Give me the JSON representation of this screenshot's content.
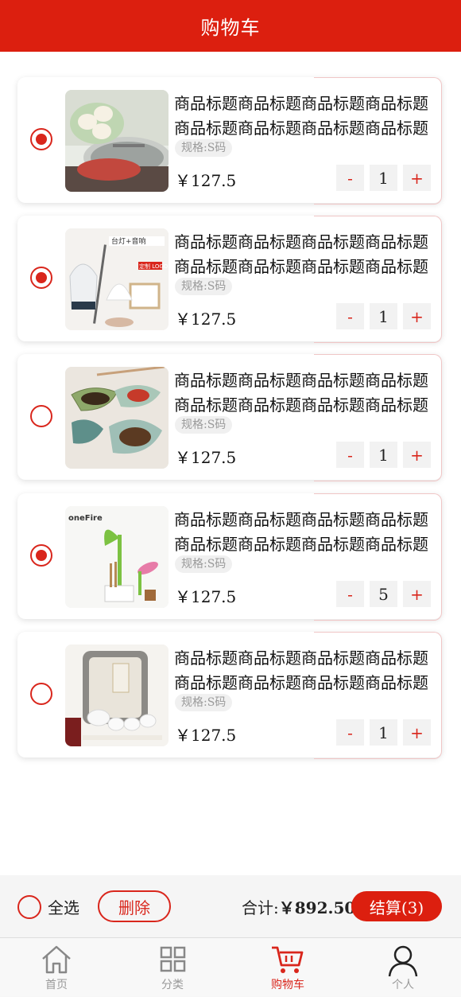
{
  "header": {
    "title": "购物车"
  },
  "items": [
    {
      "title": "商品标题商品标题商品标题商品标题商品标题商品标题商品标题商品标题",
      "spec": "规格:S码",
      "price": "￥127.5",
      "qty": "1",
      "checked": true,
      "image": "steamed-buns-pan"
    },
    {
      "title": "商品标题商品标题商品标题商品标题商品标题商品标题商品标题商品标题",
      "spec": "规格:S码",
      "price": "￥127.5",
      "qty": "1",
      "checked": true,
      "image": "desk-lamp-speaker",
      "image_texts": [
        "台灯+音响",
        "定制 LOGO"
      ]
    },
    {
      "title": "商品标题商品标题商品标题商品标题商品标题商品标题商品标题商品标题",
      "spec": "规格:S码",
      "price": "￥127.5",
      "qty": "1",
      "checked": false,
      "image": "leaf-dishes"
    },
    {
      "title": "商品标题商品标题商品标题商品标题商品标题商品标题商品标题商品标题",
      "spec": "规格:S码",
      "price": "￥127.5",
      "qty": "5",
      "checked": true,
      "image": "sprout-lamp",
      "image_texts": [
        "oneFire"
      ]
    },
    {
      "title": "商品标题商品标题商品标题商品标题商品标题商品标题商品标题商品标题",
      "spec": "规格:S码",
      "price": "￥127.5",
      "qty": "1",
      "checked": false,
      "image": "tea-set-bag"
    }
  ],
  "stepper": {
    "minus": "-",
    "plus": "+"
  },
  "footer": {
    "select_all_label": "全选",
    "delete_label": "删除",
    "total_label": "合计:",
    "total_value": "￥892.50",
    "checkout_label": "结算(3)"
  },
  "tabbar": [
    {
      "label": "首页",
      "icon": "home-icon",
      "active": false
    },
    {
      "label": "分类",
      "icon": "grid-icon",
      "active": false
    },
    {
      "label": "购物车",
      "icon": "cart-icon",
      "active": true
    },
    {
      "label": "个人",
      "icon": "user-icon",
      "active": false
    }
  ],
  "colors": {
    "accent": "#dc1f0f",
    "radio": "#d9261c"
  }
}
